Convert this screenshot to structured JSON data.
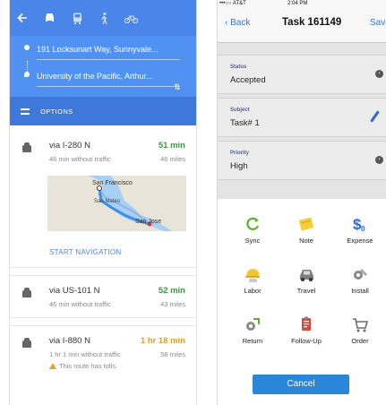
{
  "maps": {
    "travel_modes": [
      "car-icon",
      "transit-icon",
      "walk-icon",
      "bike-icon"
    ],
    "origin": "191 Locksunart Way, Sunnyvale...",
    "destination": "University of the Pacific, Arthur...",
    "options_label": "OPTIONS",
    "routes": [
      {
        "via": "via I-280 N",
        "duration": "51 min",
        "duration_color": "#3b9a3b",
        "subtext": "46 min without traffic",
        "distance": "46 miles",
        "map_labels": [
          "San Francisco",
          "San Mateo",
          "San Jose"
        ],
        "action": "START NAVIGATION"
      },
      {
        "via": "via US-101 N",
        "duration": "52 min",
        "duration_color": "#3b9a3b",
        "subtext": "46 min without traffic",
        "distance": "43 miles"
      },
      {
        "via": "via I-880 N",
        "duration": "1 hr 18 min",
        "duration_color": "#e8a317",
        "subtext": "1 hr 1 min without traffic",
        "distance": "58 miles",
        "warning": "This route has tolls."
      }
    ],
    "colors": {
      "accent": "#4a86ea",
      "header": "#5191f2",
      "options_bar": "#3e78d8"
    }
  },
  "task": {
    "statusbar": {
      "carrier": "•••○○ AT&T",
      "time": "2:04 PM"
    },
    "nav": {
      "back": "Back",
      "title": "Task 161149",
      "save": "Save"
    },
    "fields": [
      {
        "label": "Status",
        "value": "Accepted",
        "control": "chevron"
      },
      {
        "label": "Subject",
        "value": "Task# 1",
        "control": "pencil"
      },
      {
        "label": "Priority",
        "value": "High",
        "control": "chevron"
      }
    ],
    "actions": [
      {
        "label": "Sync",
        "icon": "sync-icon"
      },
      {
        "label": "Note",
        "icon": "note-icon"
      },
      {
        "label": "Expense",
        "icon": "expense-icon"
      },
      {
        "label": "Labor",
        "icon": "labor-icon"
      },
      {
        "label": "Travel",
        "icon": "travel-icon"
      },
      {
        "label": "Install",
        "icon": "install-icon"
      },
      {
        "label": "Return",
        "icon": "return-icon"
      },
      {
        "label": "Follow-Up",
        "icon": "follow-up-icon"
      },
      {
        "label": "Order",
        "icon": "order-icon"
      }
    ],
    "cancel": "Cancel",
    "colors": {
      "accent": "#2a86d8"
    }
  }
}
